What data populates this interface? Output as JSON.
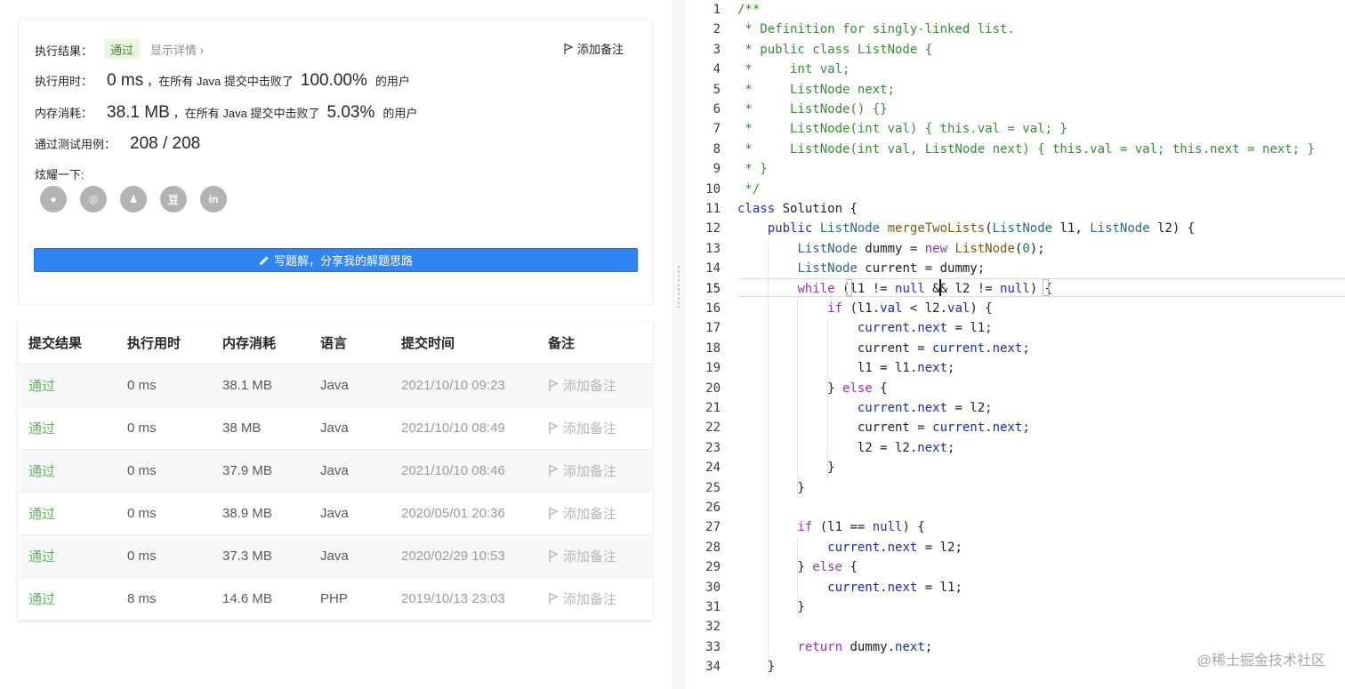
{
  "result": {
    "label": "执行结果：",
    "status": "通过",
    "detail": "显示详情 ›",
    "add_note": "添加备注",
    "runtime_label": "执行用时：",
    "runtime_value": "0 ms",
    "beat_prefix": "，在所有 Java 提交中击败了",
    "runtime_pct": "100.00%",
    "users_suffix": "的用户",
    "memory_label": "内存消耗：",
    "memory_value": "38.1 MB",
    "memory_pct": "5.03%",
    "tests_label": "通过测试用例：",
    "tests_value": "208 / 208",
    "share_label": "炫耀一下:",
    "share_icons": [
      "wechat-icon",
      "weibo-icon",
      "qq-icon",
      "douban-icon",
      "linkedin-icon"
    ],
    "share_glyphs": [
      "●",
      "◎",
      "♟",
      "豆",
      "in"
    ],
    "write_button": "写题解，分享我的解题思路"
  },
  "submissions": {
    "headers": [
      "提交结果",
      "执行用时",
      "内存消耗",
      "语言",
      "提交时间",
      "备注"
    ],
    "rows": [
      {
        "status": "通过",
        "time": "0 ms",
        "memory": "38.1 MB",
        "lang": "Java",
        "date": "2021/10/10 09:23",
        "note": "添加备注"
      },
      {
        "status": "通过",
        "time": "0 ms",
        "memory": "38 MB",
        "lang": "Java",
        "date": "2021/10/10 08:49",
        "note": "添加备注"
      },
      {
        "status": "通过",
        "time": "0 ms",
        "memory": "37.9 MB",
        "lang": "Java",
        "date": "2021/10/10 08:46",
        "note": "添加备注"
      },
      {
        "status": "通过",
        "time": "0 ms",
        "memory": "38.9 MB",
        "lang": "Java",
        "date": "2020/05/01 20:36",
        "note": "添加备注"
      },
      {
        "status": "通过",
        "time": "0 ms",
        "memory": "37.3 MB",
        "lang": "Java",
        "date": "2020/02/29 10:53",
        "note": "添加备注"
      },
      {
        "status": "通过",
        "time": "8 ms",
        "memory": "14.6 MB",
        "lang": "PHP",
        "date": "2019/10/13 23:03",
        "note": "添加备注"
      }
    ]
  },
  "editor": {
    "current_line": 15,
    "lines": [
      [
        [
          "/**",
          "cmt"
        ]
      ],
      [
        [
          " * Definition for singly-linked list.",
          "cmt"
        ]
      ],
      [
        [
          " * public class ListNode {",
          "cmt"
        ]
      ],
      [
        [
          " *     int val;",
          "cmt"
        ]
      ],
      [
        [
          " *     ListNode next;",
          "cmt"
        ]
      ],
      [
        [
          " *     ListNode() {}",
          "cmt"
        ]
      ],
      [
        [
          " *     ListNode(int val) { this.val = val; }",
          "cmt"
        ]
      ],
      [
        [
          " *     ListNode(int val, ListNode next) { this.val = val; this.next = next; }",
          "cmt"
        ]
      ],
      [
        [
          " * }",
          "cmt"
        ]
      ],
      [
        [
          " */",
          "cmt"
        ]
      ],
      [
        [
          "class",
          "kwb"
        ],
        [
          " Solution {",
          ""
        ]
      ],
      [
        [
          "    ",
          ""
        ],
        [
          "public",
          "kwb"
        ],
        [
          " ",
          ""
        ],
        [
          "ListNode",
          "ty"
        ],
        [
          " ",
          ""
        ],
        [
          "mergeTwoLists",
          "fn"
        ],
        [
          "(",
          ""
        ],
        [
          "ListNode",
          "ty"
        ],
        [
          " l1, ",
          ""
        ],
        [
          "ListNode",
          "ty"
        ],
        [
          " l2) {",
          ""
        ]
      ],
      [
        [
          "        ",
          ""
        ],
        [
          "ListNode",
          "ty"
        ],
        [
          " dummy = ",
          ""
        ],
        [
          "new",
          "kw"
        ],
        [
          " ",
          ""
        ],
        [
          "ListNode",
          "fn"
        ],
        [
          "(",
          ""
        ],
        [
          "0",
          "num"
        ],
        [
          ");",
          ""
        ]
      ],
      [
        [
          "        ",
          ""
        ],
        [
          "ListNode",
          "ty"
        ],
        [
          " current = dummy;",
          ""
        ]
      ],
      [
        [
          "        ",
          ""
        ],
        [
          "while",
          "kw"
        ],
        [
          " (l1 != ",
          ""
        ],
        [
          "null",
          "kwb"
        ],
        [
          " && l2 != ",
          ""
        ],
        [
          "null",
          "kwb"
        ],
        [
          ") {",
          ""
        ]
      ],
      [
        [
          "            ",
          ""
        ],
        [
          "if",
          "kw"
        ],
        [
          " (l1.",
          ""
        ],
        [
          "val",
          "pr"
        ],
        [
          " < l2.",
          ""
        ],
        [
          "val",
          "pr"
        ],
        [
          ") {",
          ""
        ]
      ],
      [
        [
          "                ",
          ""
        ],
        [
          "current",
          "pr"
        ],
        [
          ".",
          ""
        ],
        [
          "next",
          "pr"
        ],
        [
          " = l1;",
          ""
        ]
      ],
      [
        [
          "                current = ",
          ""
        ],
        [
          "current",
          "pr"
        ],
        [
          ".",
          ""
        ],
        [
          "next",
          "pr"
        ],
        [
          ";",
          ""
        ]
      ],
      [
        [
          "                l1 = l1.",
          ""
        ],
        [
          "next",
          "pr"
        ],
        [
          ";",
          ""
        ]
      ],
      [
        [
          "            } ",
          ""
        ],
        [
          "else",
          "kw"
        ],
        [
          " {",
          ""
        ]
      ],
      [
        [
          "                ",
          ""
        ],
        [
          "current",
          "pr"
        ],
        [
          ".",
          ""
        ],
        [
          "next",
          "pr"
        ],
        [
          " = l2;",
          ""
        ]
      ],
      [
        [
          "                current = ",
          ""
        ],
        [
          "current",
          "pr"
        ],
        [
          ".",
          ""
        ],
        [
          "next",
          "pr"
        ],
        [
          ";",
          ""
        ]
      ],
      [
        [
          "                l2 = l2.",
          ""
        ],
        [
          "next",
          "pr"
        ],
        [
          ";",
          ""
        ]
      ],
      [
        [
          "            }",
          ""
        ]
      ],
      [
        [
          "        }",
          ""
        ]
      ],
      [
        [
          "",
          ""
        ]
      ],
      [
        [
          "        ",
          ""
        ],
        [
          "if",
          "kw"
        ],
        [
          " (l1 == ",
          ""
        ],
        [
          "null",
          "kwb"
        ],
        [
          ") {",
          ""
        ]
      ],
      [
        [
          "            ",
          ""
        ],
        [
          "current",
          "pr"
        ],
        [
          ".",
          ""
        ],
        [
          "next",
          "pr"
        ],
        [
          " = l2;",
          ""
        ]
      ],
      [
        [
          "        } ",
          ""
        ],
        [
          "else",
          "kw"
        ],
        [
          " {",
          ""
        ]
      ],
      [
        [
          "            ",
          ""
        ],
        [
          "current",
          "pr"
        ],
        [
          ".",
          ""
        ],
        [
          "next",
          "pr"
        ],
        [
          " = l1;",
          ""
        ]
      ],
      [
        [
          "        }",
          ""
        ]
      ],
      [
        [
          "",
          ""
        ]
      ],
      [
        [
          "        ",
          ""
        ],
        [
          "return",
          "kw"
        ],
        [
          " dummy.",
          ""
        ],
        [
          "next",
          "pr"
        ],
        [
          ";",
          ""
        ]
      ],
      [
        [
          "    }",
          ""
        ]
      ]
    ]
  },
  "watermark": "@稀土掘金技术社区"
}
